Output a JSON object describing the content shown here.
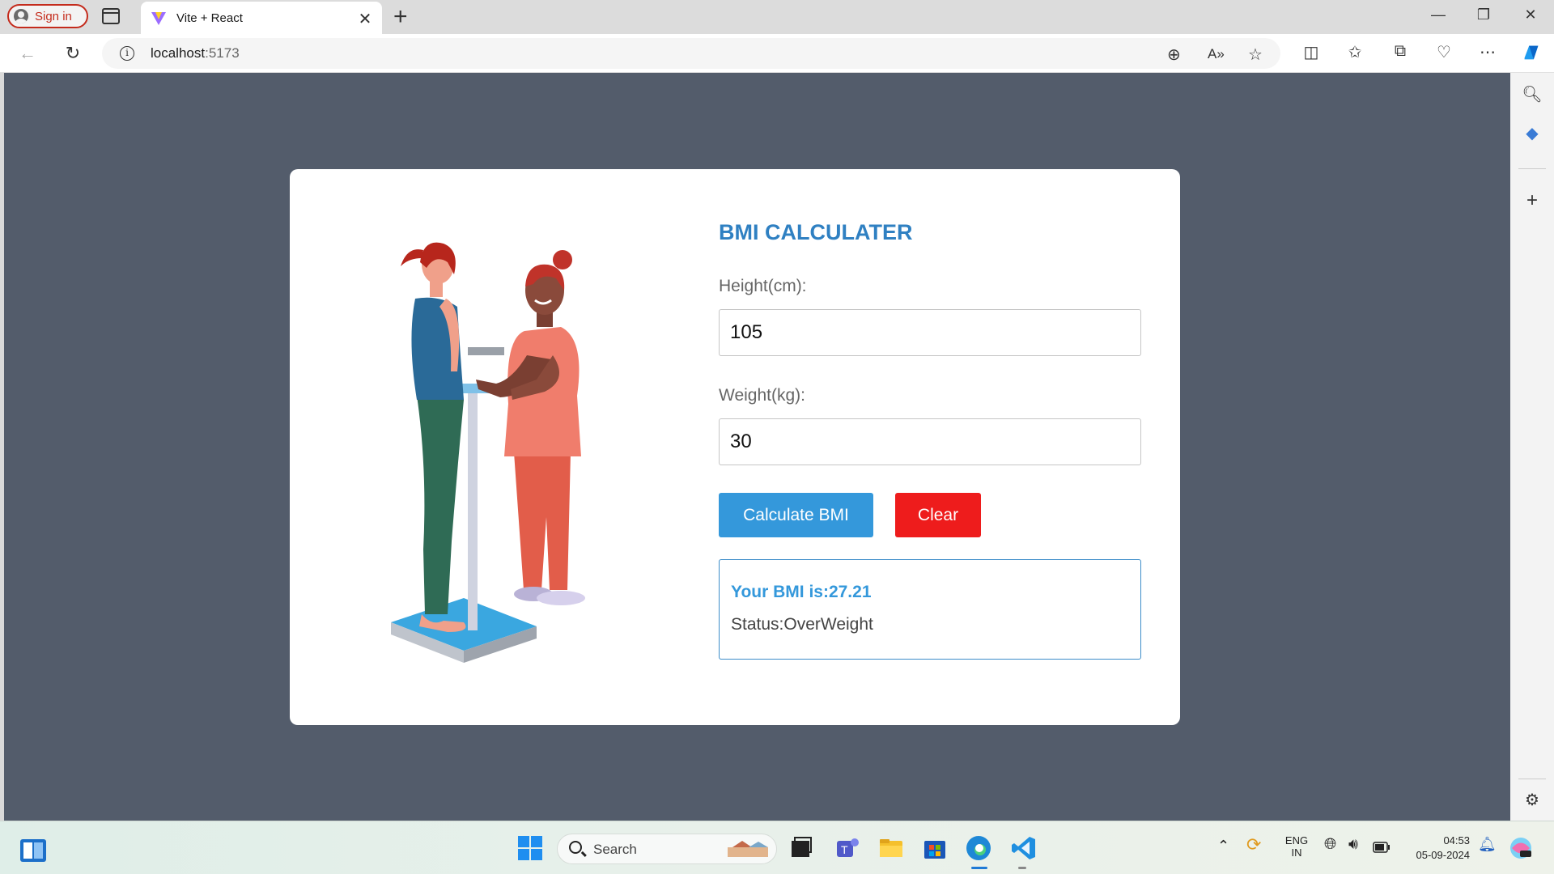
{
  "browser": {
    "sign_in_label": "Sign in",
    "tab_title": "Vite + React",
    "url_host": "localhost",
    "url_port": ":5173"
  },
  "app": {
    "title": "BMI CALCULATER",
    "height_label": "Height(cm):",
    "height_value": "105",
    "weight_label": "Weight(kg):",
    "weight_value": "30",
    "calculate_label": "Calculate BMI",
    "clear_label": "Clear",
    "result_bmi": "Your BMI is:27.21",
    "result_status": "Status:OverWeight"
  },
  "taskbar": {
    "search_placeholder": "Search",
    "lang_top": "ENG",
    "lang_bottom": "IN",
    "time": "04:53",
    "date": "05-09-2024"
  },
  "colors": {
    "page_background": "#535c6b",
    "title_blue": "#2f80c2",
    "calculate_button": "#3498db",
    "clear_button": "#ee1c1c"
  }
}
